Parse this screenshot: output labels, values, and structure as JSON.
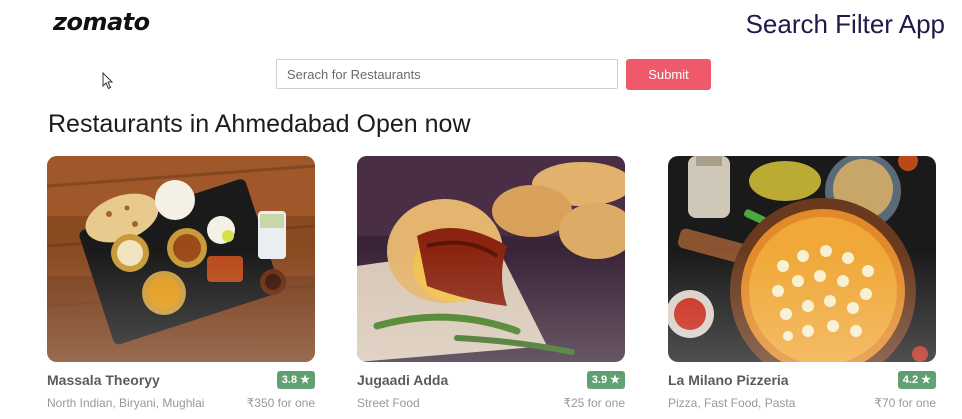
{
  "header": {
    "logo_text": "zomato",
    "app_title": "Search Filter App"
  },
  "search": {
    "placeholder": "Serach for Restaurants",
    "value": "",
    "submit_label": "Submit"
  },
  "section_title": "Restaurants in Ahmedabad Open now",
  "colors": {
    "submit_bg": "#ef5a6a",
    "rating_bg": "#267e3e",
    "app_title": "#1e1b4b"
  },
  "restaurants": [
    {
      "name": "Massala Theoryy",
      "rating": "3.8 ★",
      "cuisine": "North Indian, Biryani, Mughlai",
      "price": "₹350 for one"
    },
    {
      "name": "Jugaadi Adda",
      "rating": "3.9 ★",
      "cuisine": "Street Food",
      "price": "₹25 for one"
    },
    {
      "name": "La Milano Pizzeria",
      "rating": "4.2 ★",
      "cuisine": "Pizza, Fast Food, Pasta",
      "price": "₹70 for one"
    }
  ]
}
